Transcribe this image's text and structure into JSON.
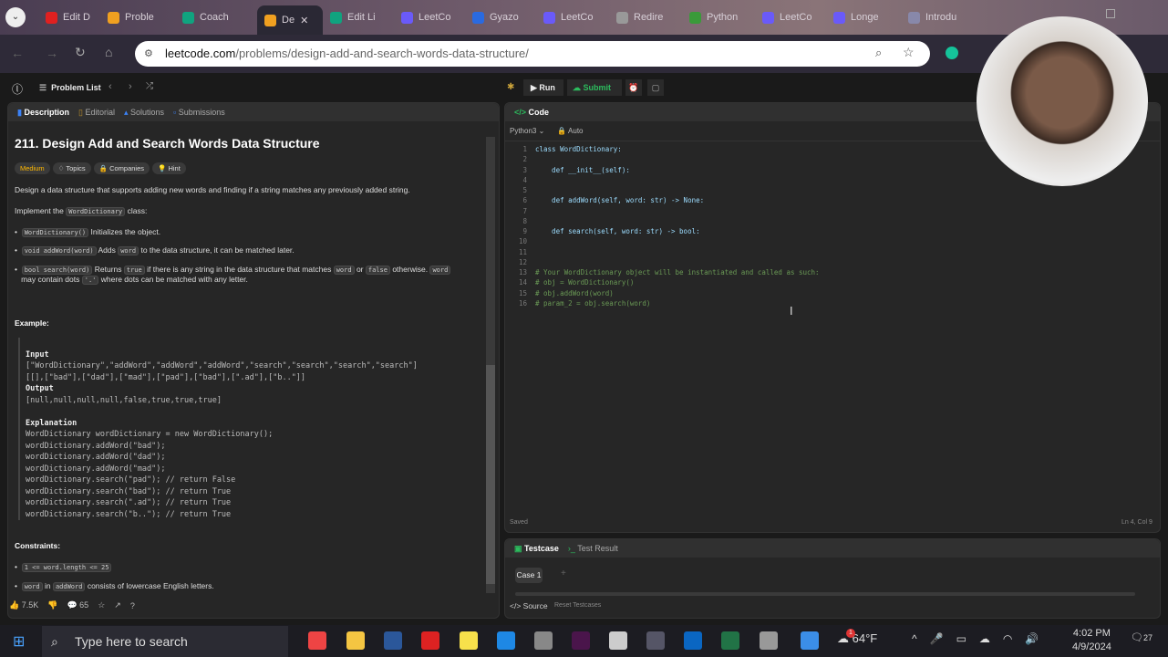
{
  "browser": {
    "tabs": [
      {
        "label": "Edit D",
        "color": "#e02020"
      },
      {
        "label": "Proble",
        "color": "#f0a020"
      },
      {
        "label": "Coach",
        "color": "#10a37f"
      },
      {
        "label": "De",
        "color": "#f0a020",
        "active": true
      },
      {
        "label": "Edit Li",
        "color": "#10a37f"
      },
      {
        "label": "LeetCo",
        "color": "#6a5af9"
      },
      {
        "label": "Gyazo",
        "color": "#2a6ae0"
      },
      {
        "label": "LeetCo",
        "color": "#6a5af9"
      },
      {
        "label": "Redire",
        "color": "#999"
      },
      {
        "label": "Python",
        "color": "#3a9a3a"
      },
      {
        "label": "LeetCo",
        "color": "#6a5af9"
      },
      {
        "label": "Longe",
        "color": "#6a5af9"
      },
      {
        "label": "Introdu",
        "color": "#88a"
      }
    ],
    "url_host": "leetcode.com",
    "url_path": "/problems/design-add-and-search-words-data-structure/"
  },
  "nav": {
    "problem_list": "Problem List",
    "run": "Run",
    "submit": "Submit"
  },
  "left": {
    "tabs": [
      "Description",
      "Editorial",
      "Solutions",
      "Submissions"
    ],
    "title": "211. Design Add and Search Words Data Structure",
    "tags": [
      "Medium",
      "Topics",
      "Companies",
      "Hint"
    ],
    "intro": "Design a data structure that supports adding new words and finding if a string matches any previously added string.",
    "implement_pre": "Implement the",
    "implement_code": "WordDictionary",
    "implement_post": "class:",
    "b1_code": "WordDictionary()",
    "b1_text": "Initializes the object.",
    "b2_code": "void addWord(word)",
    "b2_a": "Adds",
    "b2_code2": "word",
    "b2_b": "to the data structure, it can be matched later.",
    "b3_code": "bool search(word)",
    "b3_a": "Returns",
    "b3_true": "true",
    "b3_b": "if there is any string in the data structure that matches",
    "b3_word": "word",
    "b3_or": "or",
    "b3_false": "false",
    "b3_c": "otherwise.",
    "b3_word2": "word",
    "b3_d": "may contain dots",
    "b3_dot": "'.'",
    "b3_e": "where dots can be matched with any letter.",
    "example_label": "Example:",
    "input_label": "Input",
    "input_1": "[\"WordDictionary\",\"addWord\",\"addWord\",\"addWord\",\"search\",\"search\",\"search\",\"search\"]",
    "input_2": "[[],[\"bad\"],[\"dad\"],[\"mad\"],[\"pad\"],[\"bad\"],[\".ad\"],[\"b..\"]]",
    "output_label": "Output",
    "output": "[null,null,null,null,false,true,true,true]",
    "explanation_label": "Explanation",
    "explanation": [
      "WordDictionary wordDictionary = new WordDictionary();",
      "wordDictionary.addWord(\"bad\");",
      "wordDictionary.addWord(\"dad\");",
      "wordDictionary.addWord(\"mad\");",
      "wordDictionary.search(\"pad\"); // return False",
      "wordDictionary.search(\"bad\"); // return True",
      "wordDictionary.search(\".ad\"); // return True",
      "wordDictionary.search(\"b..\"); // return True"
    ],
    "constraints_label": "Constraints:",
    "c1": "1 <= word.length <= 25",
    "c2_code": "word",
    "c2_in": "in",
    "c2_code2": "addWord",
    "c2_text": "consists of lowercase English letters.",
    "likes": "7.5K",
    "comments": "65"
  },
  "editor": {
    "header": "Code",
    "language": "Python3",
    "mode": "Auto",
    "lines": [
      "class WordDictionary:",
      "",
      "    def __init__(self):",
      "",
      "",
      "    def addWord(self, word: str) -> None:",
      "",
      "",
      "    def search(self, word: str) -> bool:",
      "",
      "",
      "",
      "# Your WordDictionary object will be instantiated and called as such:",
      "# obj = WordDictionary()",
      "# obj.addWord(word)",
      "# param_2 = obj.search(word)"
    ],
    "status": "Saved",
    "cursor": "Ln 4, Col 9"
  },
  "testpanel": {
    "tabs": [
      "Testcase",
      "Test Result"
    ],
    "case": "Case 1",
    "source": "Source",
    "reset": "Reset Testcases"
  },
  "taskbar": {
    "search_placeholder": "Type here to search",
    "weather": "64°F",
    "weather_badge": "1",
    "time": "4:02 PM",
    "date": "4/9/2024",
    "notifications": "27"
  }
}
